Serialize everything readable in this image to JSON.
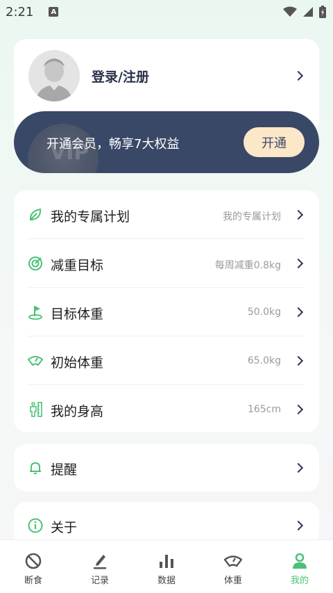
{
  "status_bar": {
    "time": "2:21",
    "a_badge": "A"
  },
  "profile": {
    "login_label": "登录/注册"
  },
  "vip": {
    "banner_text": "开通会员，畅享7大权益",
    "button_label": "开通",
    "coin_text": "VIP"
  },
  "plan_rows": [
    {
      "label": "我的专属计划",
      "value": "我的专属计划",
      "icon": "leaf-icon"
    },
    {
      "label": "减重目标",
      "value": "每周减重0.8kg",
      "icon": "target-icon"
    },
    {
      "label": "目标体重",
      "value": "50.0kg",
      "icon": "flag-icon"
    },
    {
      "label": "初始体重",
      "value": "65.0kg",
      "icon": "scale-icon"
    },
    {
      "label": "我的身高",
      "value": "165cm",
      "icon": "height-icon"
    }
  ],
  "remind": {
    "label": "提醒"
  },
  "about": {
    "label": "关于"
  },
  "tabs": [
    {
      "label": "断食",
      "icon": "fasting-icon"
    },
    {
      "label": "记录",
      "icon": "record-icon"
    },
    {
      "label": "数据",
      "icon": "data-chart-icon"
    },
    {
      "label": "体重",
      "icon": "weight-icon"
    },
    {
      "label": "我的",
      "icon": "profile-icon",
      "active": true
    }
  ],
  "colors": {
    "accent": "#4cc178",
    "vip_bg": "#3a4867",
    "vip_button": "#fde7c9"
  }
}
